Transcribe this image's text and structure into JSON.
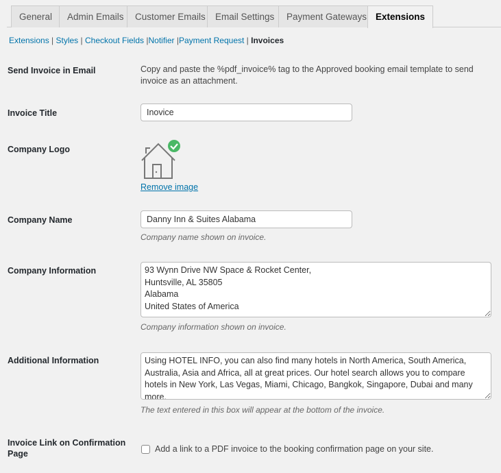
{
  "tabs": [
    {
      "label": "General"
    },
    {
      "label": "Admin Emails"
    },
    {
      "label": "Customer Emails"
    },
    {
      "label": "Email Settings"
    },
    {
      "label": "Payment Gateways"
    },
    {
      "label": "Extensions",
      "active": true
    }
  ],
  "subnav": {
    "items": [
      "Extensions",
      "Styles",
      "Checkout Fields",
      "Notifier",
      "Payment Request"
    ],
    "current": "Invoices"
  },
  "send_invoice": {
    "label": "Send Invoice in Email",
    "text": "Copy and paste the %pdf_invoice% tag to the Approved booking email template to send invoice as an attachment."
  },
  "invoice_title": {
    "label": "Invoice Title",
    "value": "Inovice"
  },
  "company_logo": {
    "label": "Company Logo",
    "icon": "house-icon",
    "badge_icon": "check-circle-icon",
    "badge_color": "#4ab866",
    "remove_label": "Remove image"
  },
  "company_name": {
    "label": "Company Name",
    "value": "Danny Inn & Suites Alabama",
    "hint": "Company name shown on invoice."
  },
  "company_info": {
    "label": "Company Information",
    "value": "93 Wynn Drive NW Space & Rocket Center,\nHuntsville, AL 35805\nAlabama\nUnited States of America",
    "hint": "Company information shown on invoice."
  },
  "additional_info": {
    "label": "Additional Information",
    "value": "Using HOTEL INFO, you can also find many hotels in North America, South America, Australia, Asia and Africa, all at great prices. Our hotel search allows you to compare hotels in New York, Las Vegas, Miami, Chicago, Bangkok, Singapore, Dubai and many more.",
    "hint": "The text entered in this box will appear at the bottom of the invoice."
  },
  "invoice_link": {
    "label": "Invoice Link on Confirmation Page",
    "checkbox_label": "Add a link to a PDF invoice to the booking confirmation page on your site.",
    "checked": false
  }
}
